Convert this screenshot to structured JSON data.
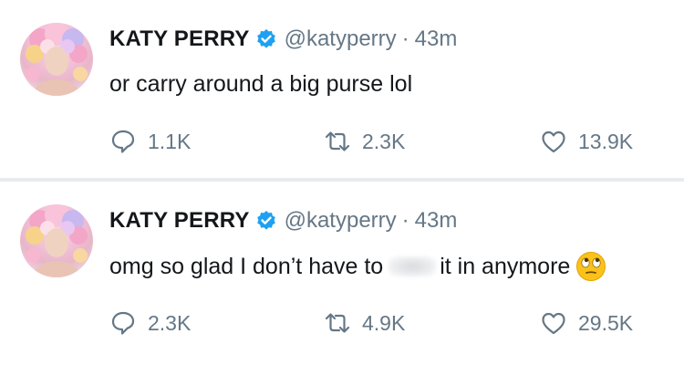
{
  "tweets": [
    {
      "name": "KATY PERRY",
      "handle": "@katyperry",
      "separator": "·",
      "time": "43m",
      "text": "or carry around a big purse lol",
      "replies": "1.1K",
      "retweets": "2.3K",
      "likes": "13.9K"
    },
    {
      "name": "KATY PERRY",
      "handle": "@katyperry",
      "separator": "·",
      "time": "43m",
      "text_before": "omg so glad I don’t have to",
      "text_after": "it in anymore",
      "emoji": "eye-roll-emoji",
      "replies": "2.3K",
      "retweets": "4.9K",
      "likes": "29.5K"
    }
  ],
  "colors": {
    "text": "#14171a",
    "secondary": "#657786",
    "verified": "#1da1f2",
    "separator": "#e6ecf0"
  },
  "icons": {
    "reply": "reply-icon",
    "retweet": "retweet-icon",
    "like": "heart-icon",
    "verified": "verified-badge-icon"
  }
}
